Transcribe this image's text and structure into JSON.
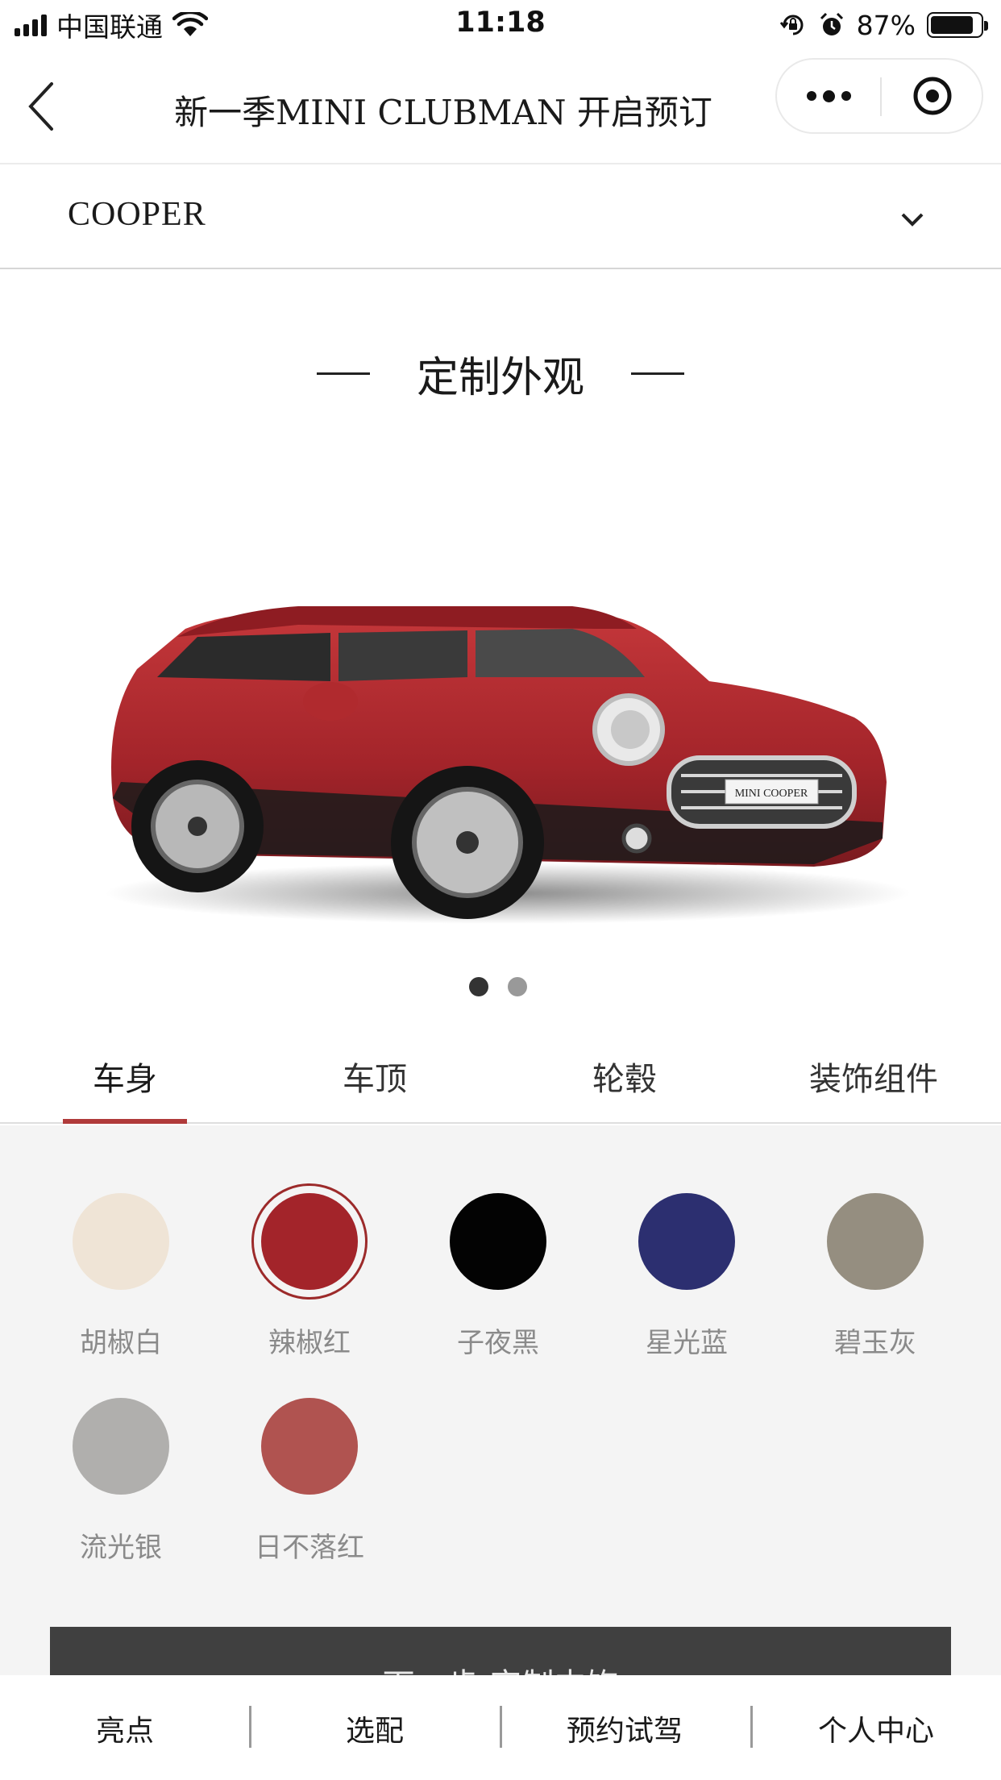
{
  "status_bar": {
    "carrier": "中国联通",
    "time": "11:18",
    "battery_percent": "87%",
    "battery_level": 0.87
  },
  "nav": {
    "title": "新一季MINI CLUBMAN 开启预订",
    "back_icon": "chevron-left-icon",
    "more_icon": "more-dots-icon",
    "close_icon": "target-close-icon"
  },
  "model_select": {
    "value": "COOPER",
    "icon": "chevron-down-icon"
  },
  "section": {
    "title": "定制外观"
  },
  "car_image": {
    "plate_text": "MINI COOPER",
    "body_color": "#b0262a"
  },
  "carousel": {
    "count": 2,
    "active_index": 0
  },
  "tabs": [
    {
      "label": "车身",
      "active": true
    },
    {
      "label": "车顶",
      "active": false
    },
    {
      "label": "轮毂",
      "active": false
    },
    {
      "label": "装饰组件",
      "active": false
    }
  ],
  "accent_color": "#b03a3a",
  "colors": [
    {
      "name": "胡椒白",
      "hex": "#efe4d6",
      "selected": false
    },
    {
      "name": "辣椒红",
      "hex": "#a3242a",
      "selected": true
    },
    {
      "name": "子夜黑",
      "hex": "#030303",
      "selected": false
    },
    {
      "name": "星光蓝",
      "hex": "#2c2f70",
      "selected": false
    },
    {
      "name": "碧玉灰",
      "hex": "#958e80",
      "selected": false
    },
    {
      "name": "流光银",
      "hex": "#b0afad",
      "selected": false
    },
    {
      "name": "日不落红",
      "hex": "#b05350",
      "selected": false
    }
  ],
  "next_button": {
    "label": "下一步 定制内饰"
  },
  "bottom_nav": [
    {
      "label": "亮点"
    },
    {
      "label": "选配"
    },
    {
      "label": "预约试驾"
    },
    {
      "label": "个人中心"
    }
  ]
}
